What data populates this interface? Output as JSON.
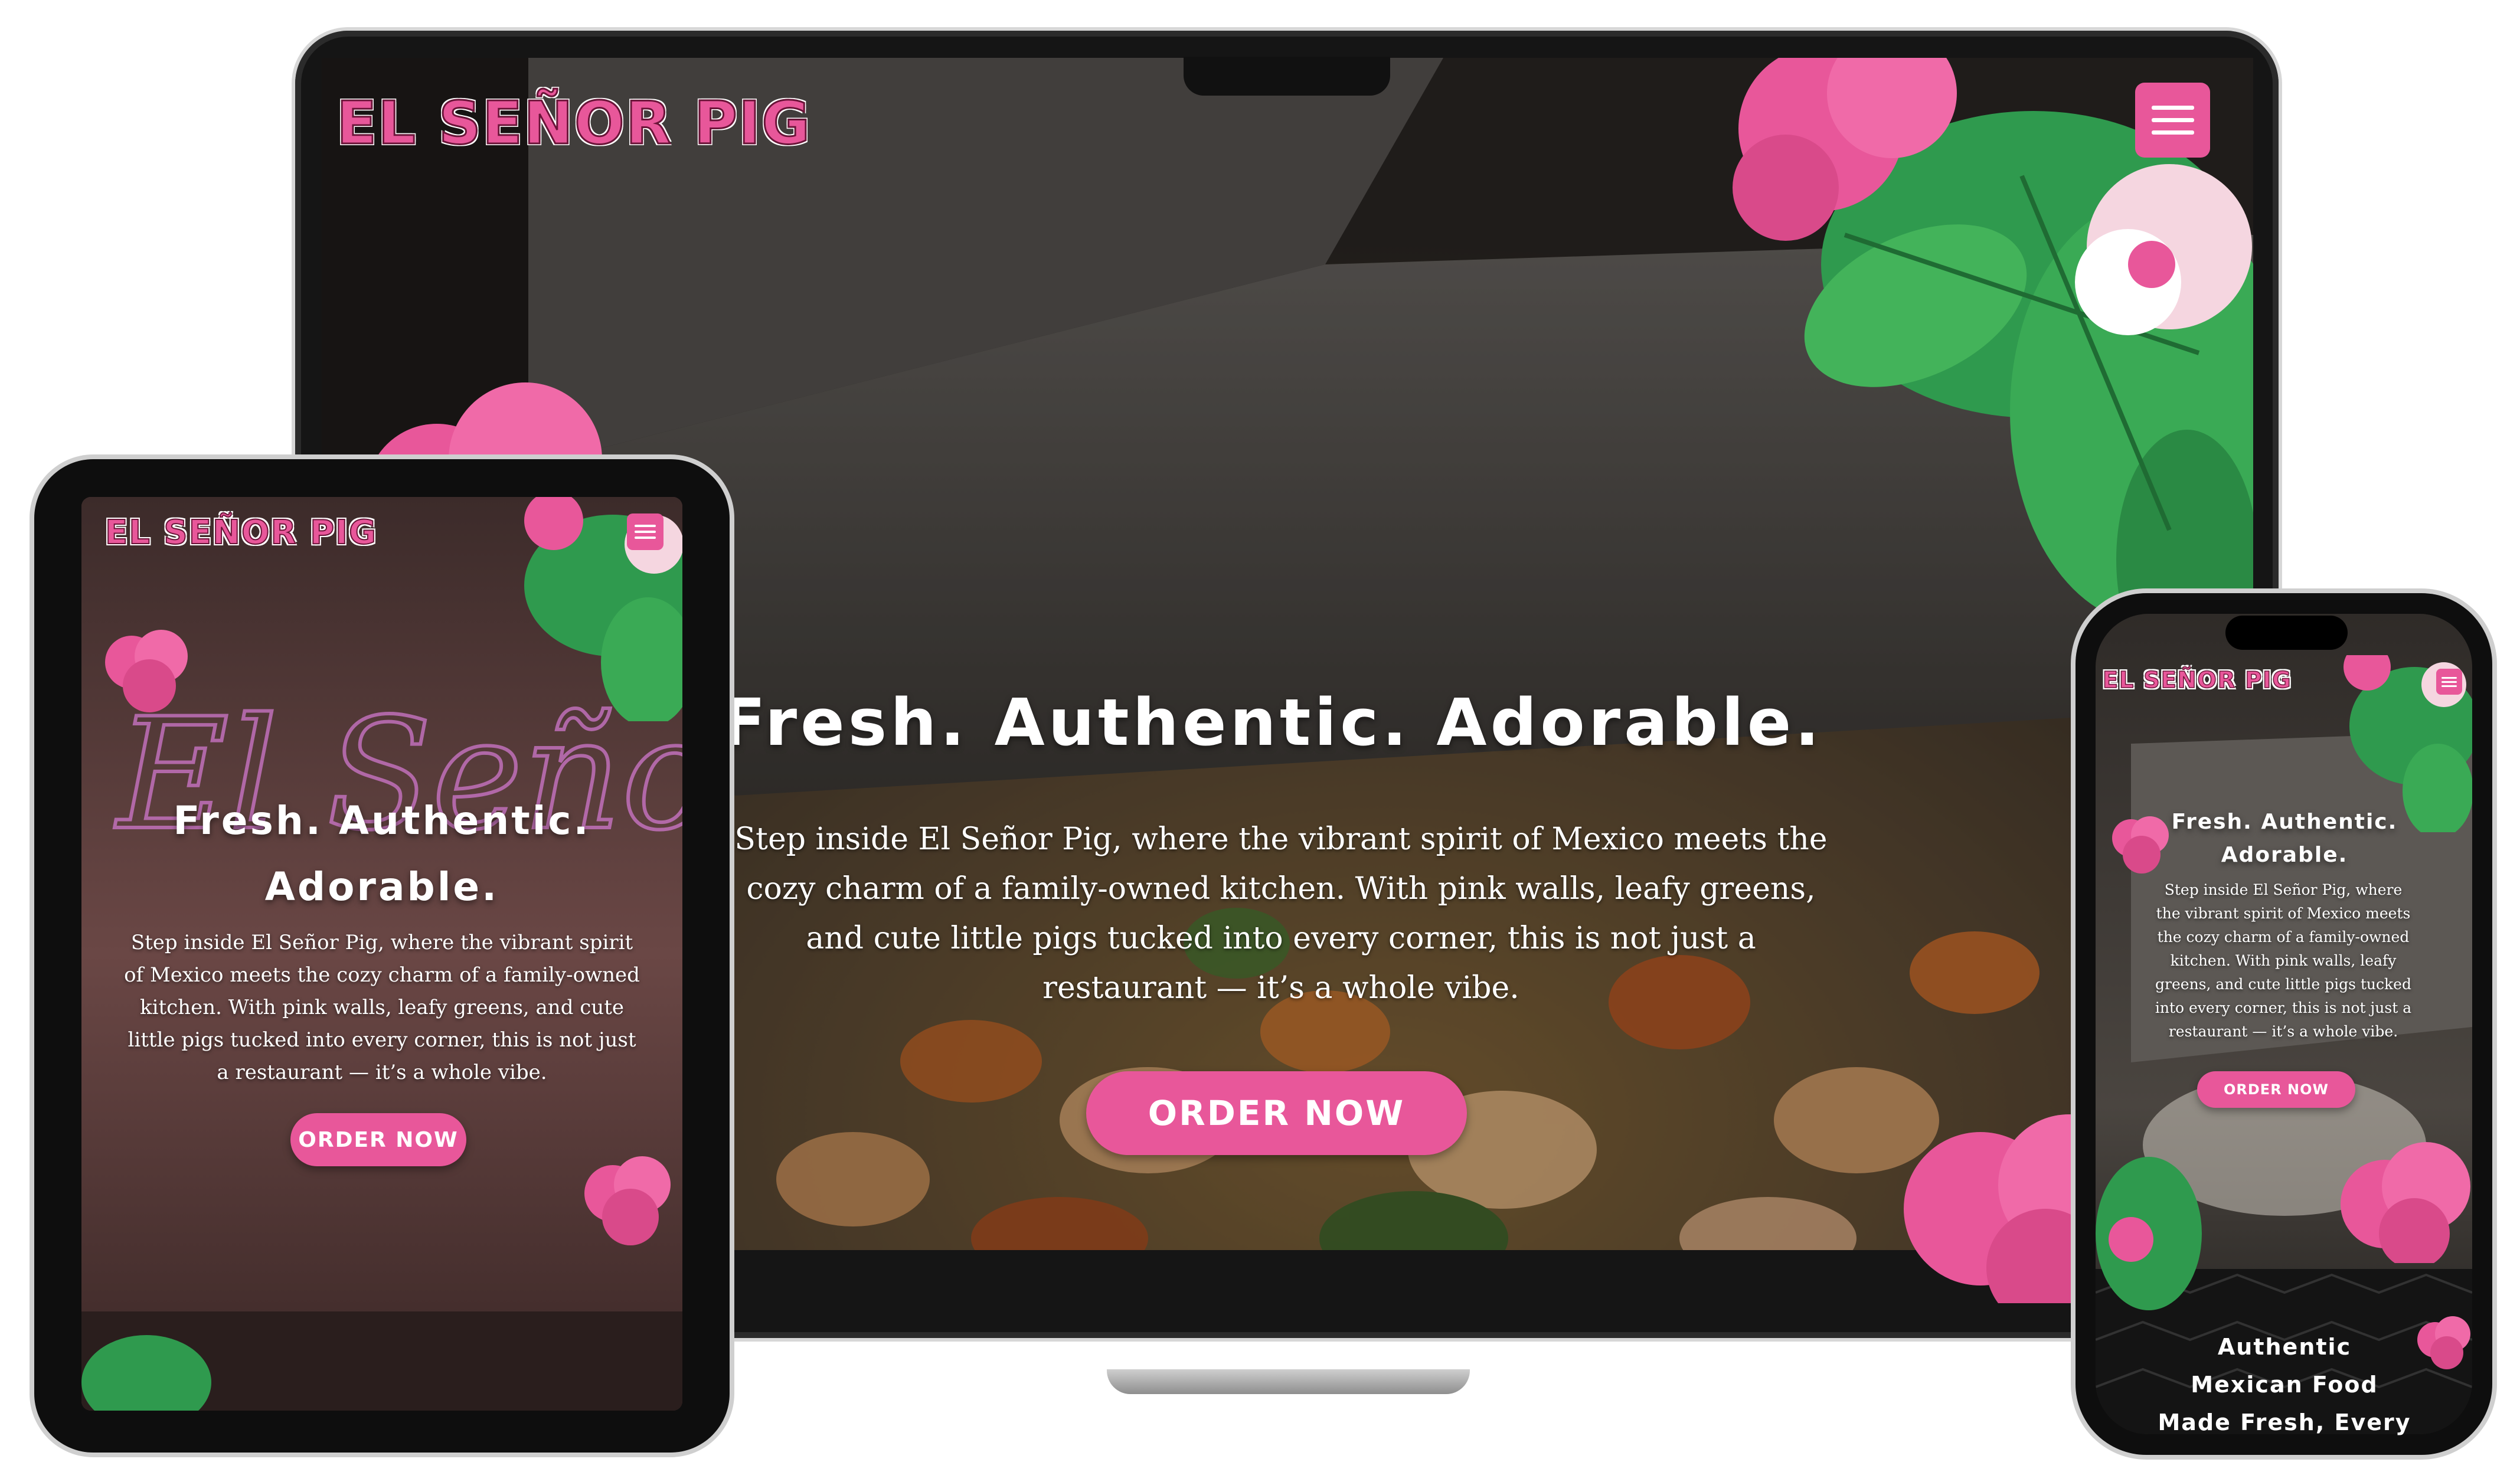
{
  "brand": {
    "logo_text": "EL SEÑOR PIG",
    "accent_color": "#e8579a",
    "leaf_color": "#2f9a4e"
  },
  "laptop": {
    "hero_title": "Fresh. Authentic. Adorable.",
    "hero_text": "Step inside El Señor Pig, where the vibrant spirit of Mexico meets the cozy charm of a family-owned kitchen. With pink walls, leafy greens, and cute little pigs tucked into every corner, this is not just a restaurant — it’s a whole vibe.",
    "order_button": "ORDER NOW",
    "menu_icon": "hamburger-menu-icon"
  },
  "tablet": {
    "hero_title_line1": "Fresh. Authentic.",
    "hero_title_line2": "Adorable.",
    "hero_text": "Step inside El Señor Pig, where the vibrant spirit of Mexico meets the cozy charm of a family-owned kitchen. With pink walls, leafy greens, and cute little pigs tucked into every corner, this is not just a restaurant — it’s a whole vibe.",
    "order_button": "ORDER NOW",
    "neon_sign": "El Señor Pig",
    "menu_icon": "hamburger-menu-icon"
  },
  "phone": {
    "hero_title_line1": "Fresh. Authentic.",
    "hero_title_line2": "Adorable.",
    "hero_text": "Step inside El Señor Pig, where the vibrant spirit of Mexico meets the cozy charm of a family-owned kitchen. With pink walls, leafy greens, and cute little pigs tucked into every corner, this is not just a restaurant — it’s a whole vibe.",
    "order_button": "ORDER NOW",
    "section_heading_line1": "Authentic",
    "section_heading_line2": "Mexican Food",
    "section_heading_line3": "Made Fresh, Every",
    "menu_icon": "hamburger-menu-icon"
  }
}
